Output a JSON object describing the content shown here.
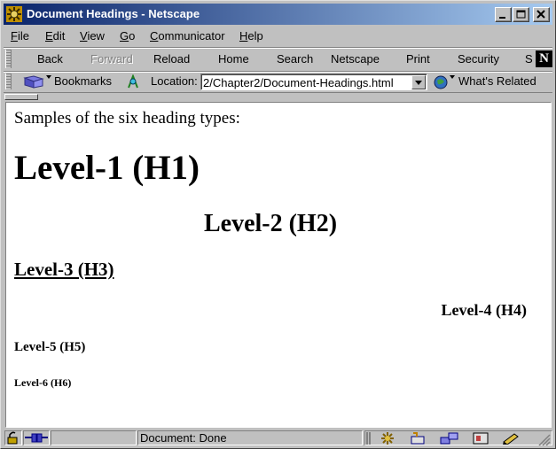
{
  "window": {
    "title": "Document Headings - Netscape"
  },
  "menu": [
    {
      "accel": "F",
      "rest": "ile"
    },
    {
      "accel": "E",
      "rest": "dit"
    },
    {
      "accel": "V",
      "rest": "iew"
    },
    {
      "accel": "G",
      "rest": "o"
    },
    {
      "accel": "C",
      "rest": "ommunicator"
    },
    {
      "accel": "H",
      "rest": "elp"
    }
  ],
  "toolbar": {
    "back": "Back",
    "forward": "Forward",
    "reload": "Reload",
    "home": "Home",
    "search": "Search",
    "netscape": "Netscape",
    "print": "Print",
    "security": "Security",
    "shop": "S"
  },
  "location_bar": {
    "bookmarks": "Bookmarks",
    "location_label": "Location:",
    "url": "2/Chapter2/Document-Headings.html",
    "whats_related": "What's Related"
  },
  "content": {
    "intro": "Samples of the six heading types:",
    "h1": "Level-1 (H1)",
    "h2": "Level-2 (H2)",
    "h3": "Level-3 (H3)",
    "h4": "Level-4 (H4)",
    "h5": "Level-5 (H5)",
    "h6": "Level-6 (H6)"
  },
  "status": {
    "text": "Document: Done"
  },
  "icons": {
    "app": "netscape-wheel-icon",
    "bookmarks": "bookmarks-icon",
    "location": "location-icon",
    "whats_related": "whats-related-icon",
    "security_lock": "lock-icon",
    "online": "online-connection-icon"
  }
}
